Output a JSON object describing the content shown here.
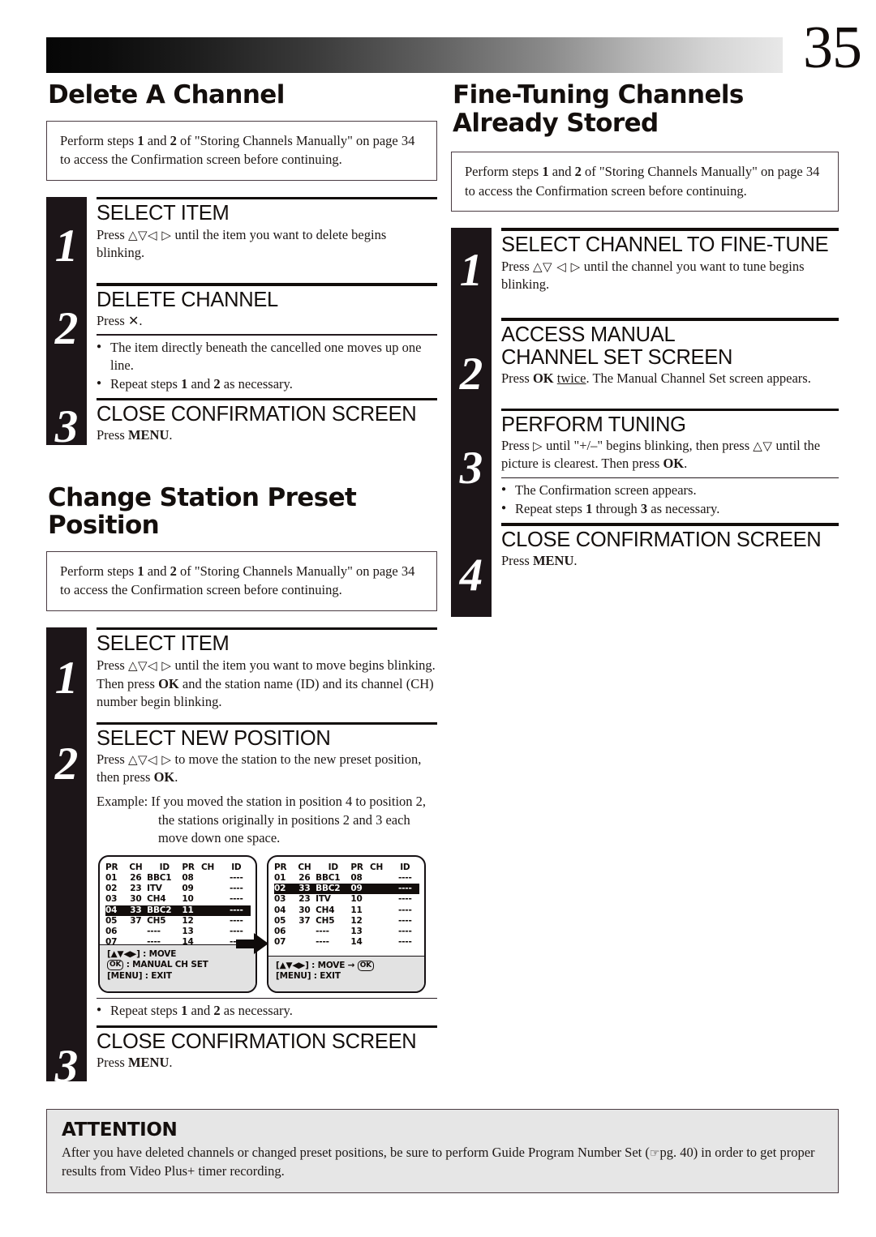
{
  "header": {
    "page_number": "35"
  },
  "left_column": {
    "section1": {
      "title": "Delete A Channel",
      "note": "Perform steps 1 and 2 of \"Storing Channels Manually\" on page 34 to access the Confirmation screen before continuing.",
      "note_part_a": "Perform steps ",
      "note_b1": "1",
      "note_part_b": " and ",
      "note_b2": "2",
      "note_part_c": " of \"Storing Channels Manually\" on page 34 to access the Confirmation screen before continuing.",
      "steps": [
        {
          "number": "1",
          "heading": "SELECT ITEM",
          "body_pre": "Press ",
          "body_arrows": "△▽◁ ▷",
          "body_post": " until the item you want to delete begins blinking."
        },
        {
          "number": "2",
          "heading": "DELETE CHANNEL",
          "body_pre": "Press ",
          "body_x": "✕",
          "body_post": ".",
          "bullets": [
            "The item directly beneath the cancelled one moves up one line.",
            "Repeat steps 1 and 2 as necessary."
          ],
          "bullet2_pre": "Repeat steps ",
          "bullet2_b1": "1",
          "bullet2_mid": " and ",
          "bullet2_b2": "2",
          "bullet2_post": " as necessary."
        },
        {
          "number": "3",
          "heading": "CLOSE CONFIRMATION SCREEN",
          "body_pre": "Press ",
          "body_bold": "MENU",
          "body_post": "."
        }
      ]
    },
    "section2": {
      "title": "Change Station Preset Position",
      "note_part_a": "Perform steps ",
      "note_b1": "1",
      "note_part_b": " and ",
      "note_b2": "2",
      "note_part_c": " of \"Storing Channels Manually\" on page 34 to access the Confirmation screen before continuing.",
      "steps": [
        {
          "number": "1",
          "heading": "SELECT ITEM",
          "body_pre": "Press ",
          "body_arrows": "△▽◁ ▷",
          "body_mid": " until the item you want to move begins blinking. Then press ",
          "body_bold": "OK",
          "body_post": " and the station name (ID) and its channel (CH) number begin blinking."
        },
        {
          "number": "2",
          "heading": "SELECT NEW POSITION",
          "body_pre": "Press ",
          "body_arrows": "△▽◁ ▷",
          "body_mid": " to move the station to the new preset position, then press ",
          "body_bold": "OK",
          "body_post": ".",
          "example_label": "Example:",
          "example_text": "If you moved the station in position 4 to position 2, the stations originally in positions 2 and 3 each move down one space.",
          "bullet_pre": "Repeat steps ",
          "bullet_b1": "1",
          "bullet_mid": " and ",
          "bullet_b2": "2",
          "bullet_post": " as necessary."
        },
        {
          "number": "3",
          "heading": "CLOSE CONFIRMATION SCREEN",
          "body_pre": "Press ",
          "body_bold": "MENU",
          "body_post": "."
        }
      ]
    }
  },
  "right_column": {
    "section": {
      "title": "Fine-Tuning Channels Already Stored",
      "title_line1": "Fine-Tuning Channels",
      "title_line2": "Already Stored",
      "note_part_a": "Perform steps ",
      "note_b1": "1",
      "note_part_b": " and ",
      "note_b2": "2",
      "note_part_c": " of \"Storing Channels Manually\" on page 34 to access the Confirmation screen before continuing.",
      "steps": [
        {
          "number": "1",
          "heading": "SELECT CHANNEL TO FINE-TUNE",
          "body_pre": "Press ",
          "body_arrows": "△▽ ◁ ▷",
          "body_post": " until the channel you want to tune begins blinking."
        },
        {
          "number": "2",
          "heading_line1": "ACCESS MANUAL",
          "heading_line2": "CHANNEL SET SCREEN",
          "body_pre": "Press ",
          "body_bold": "OK",
          "body_underline": "twice",
          "body_post": ". The Manual Channel Set screen appears."
        },
        {
          "number": "3",
          "heading": "PERFORM TUNING",
          "body_pre": "Press ",
          "body_arrow1": "▷",
          "body_mid1": " until \"+/–\" begins blinking, then press ",
          "body_arrows2": "△▽",
          "body_mid2": " until the picture is clearest. Then press ",
          "body_bold": "OK",
          "body_post": ".",
          "bullets": [
            "The Confirmation screen appears.",
            "Repeat steps 1 through 3 as necessary."
          ],
          "bullet2_pre": "Repeat steps ",
          "bullet2_b1": "1",
          "bullet2_mid": " through ",
          "bullet2_b2": "3",
          "bullet2_post": " as necessary."
        },
        {
          "number": "4",
          "heading": "CLOSE CONFIRMATION SCREEN",
          "body_pre": "Press ",
          "body_bold": "MENU",
          "body_post": "."
        }
      ]
    }
  },
  "osd_before": {
    "columns": [
      "PR",
      "CH",
      "ID",
      "PR",
      "CH",
      "ID"
    ],
    "rows": [
      {
        "pr": "01",
        "ch": "26",
        "id": "BBC1",
        "pr2": "08",
        "ch2": "",
        "id2": "----",
        "highlight": false
      },
      {
        "pr": "02",
        "ch": "23",
        "id": "ITV",
        "pr2": "09",
        "ch2": "",
        "id2": "----",
        "highlight": false
      },
      {
        "pr": "03",
        "ch": "30",
        "id": "CH4",
        "pr2": "10",
        "ch2": "",
        "id2": "----",
        "highlight": false
      },
      {
        "pr": "04",
        "ch": "33",
        "id": "BBC2",
        "pr2": "11",
        "ch2": "",
        "id2": "----",
        "highlight": true
      },
      {
        "pr": "05",
        "ch": "37",
        "id": "CH5",
        "pr2": "12",
        "ch2": "",
        "id2": "----",
        "highlight": false
      },
      {
        "pr": "06",
        "ch": "",
        "id": "----",
        "pr2": "13",
        "ch2": "",
        "id2": "----",
        "highlight": false
      },
      {
        "pr": "07",
        "ch": "",
        "id": "----",
        "pr2": "14",
        "ch2": "",
        "id2": "----",
        "highlight": false
      }
    ],
    "footer_line1": "[▲▼◀▶] : MOVE",
    "footer_line2_ok": "OK",
    "footer_line2_text": " : MANUAL CH SET",
    "footer_line3": "[MENU] : EXIT"
  },
  "osd_after": {
    "columns": [
      "PR",
      "CH",
      "ID",
      "PR",
      "CH",
      "ID"
    ],
    "rows": [
      {
        "pr": "01",
        "ch": "26",
        "id": "BBC1",
        "pr2": "08",
        "ch2": "",
        "id2": "----",
        "highlight": false
      },
      {
        "pr": "02",
        "ch": "33",
        "id": "BBC2",
        "pr2": "09",
        "ch2": "",
        "id2": "----",
        "highlight": true
      },
      {
        "pr": "03",
        "ch": "23",
        "id": "ITV",
        "pr2": "10",
        "ch2": "",
        "id2": "----",
        "highlight": false
      },
      {
        "pr": "04",
        "ch": "30",
        "id": "CH4",
        "pr2": "11",
        "ch2": "",
        "id2": "----",
        "highlight": false
      },
      {
        "pr": "05",
        "ch": "37",
        "id": "CH5",
        "pr2": "12",
        "ch2": "",
        "id2": "----",
        "highlight": false
      },
      {
        "pr": "06",
        "ch": "",
        "id": "----",
        "pr2": "13",
        "ch2": "",
        "id2": "----",
        "highlight": false
      },
      {
        "pr": "07",
        "ch": "",
        "id": "----",
        "pr2": "14",
        "ch2": "",
        "id2": "----",
        "highlight": false
      }
    ],
    "footer_line1_a": "[▲▼◀▶] : MOVE → ",
    "footer_line1_ok": "OK",
    "footer_line2": "[MENU] : EXIT"
  },
  "attention": {
    "title": "ATTENTION",
    "hand_icon": "☞",
    "text_a": "After you have deleted channels or changed preset positions, be sure to perform Guide Program Number Set (",
    "text_pg": "pg. 40",
    "text_b": ") in order to get proper results from Video Plus+ timer recording."
  }
}
